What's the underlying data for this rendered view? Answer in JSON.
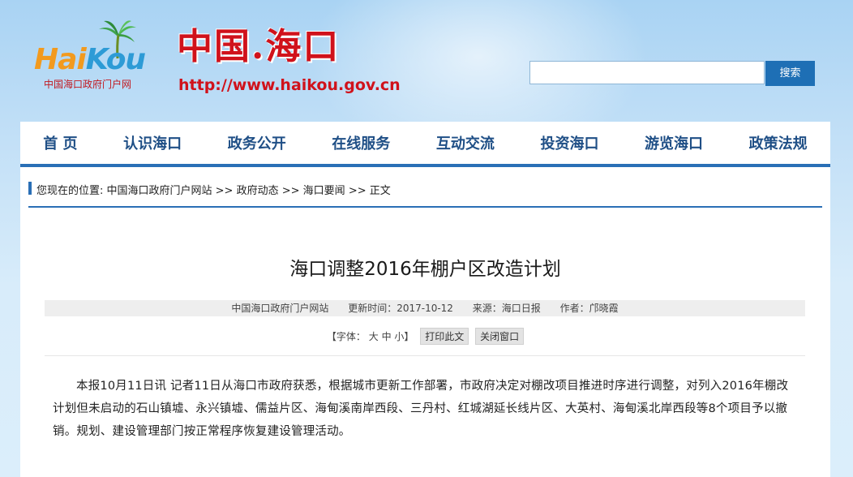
{
  "header": {
    "logo_text_part1": "Hai",
    "logo_text_part2": "Kou",
    "logo_subtitle": "中国海口政府门户网",
    "site_title": "中国.海口",
    "site_url": "http://www.haikou.gov.cn",
    "search_placeholder": "",
    "search_button": "搜索"
  },
  "nav": {
    "items": [
      "首 页",
      "认识海口",
      "政务公开",
      "在线服务",
      "互动交流",
      "投资海口",
      "游览海口",
      "政策法规"
    ]
  },
  "breadcrumb": {
    "prefix": "您现在的位置: ",
    "items": [
      "中国海口政府门户网站",
      "政府动态",
      "海口要闻",
      "正文"
    ],
    "separator": " >> "
  },
  "article": {
    "title": "海口调整2016年棚户区改造计划",
    "meta": {
      "source_site": "中国海口政府门户网站",
      "updated": "更新时间：2017-10-12",
      "origin": "来源：海口日报",
      "author": "作者：邝晓霞"
    },
    "tools": {
      "font_label": "【字体：",
      "font_large": "大",
      "font_medium": "中",
      "font_small": "小",
      "font_end": "】",
      "print": "打印此文",
      "close": "关闭窗口"
    },
    "body": "本报10月11日讯  记者11日从海口市政府获悉，根据城市更新工作部署，市政府决定对棚改项目推进时序进行调整，对列入2016年棚改计划但未启动的石山镇墟、永兴镇墟、儒益片区、海甸溪南岸西段、三丹村、红城湖延长线片区、大英村、海甸溪北岸西段等8个项目予以撤销。规划、建设管理部门按正常程序恢复建设管理活动。"
  },
  "colors": {
    "brand_red": "#d0121b",
    "nav_blue": "#2a6fb6",
    "nav_text": "#1f4f86",
    "search_button": "#1e6fb5"
  }
}
